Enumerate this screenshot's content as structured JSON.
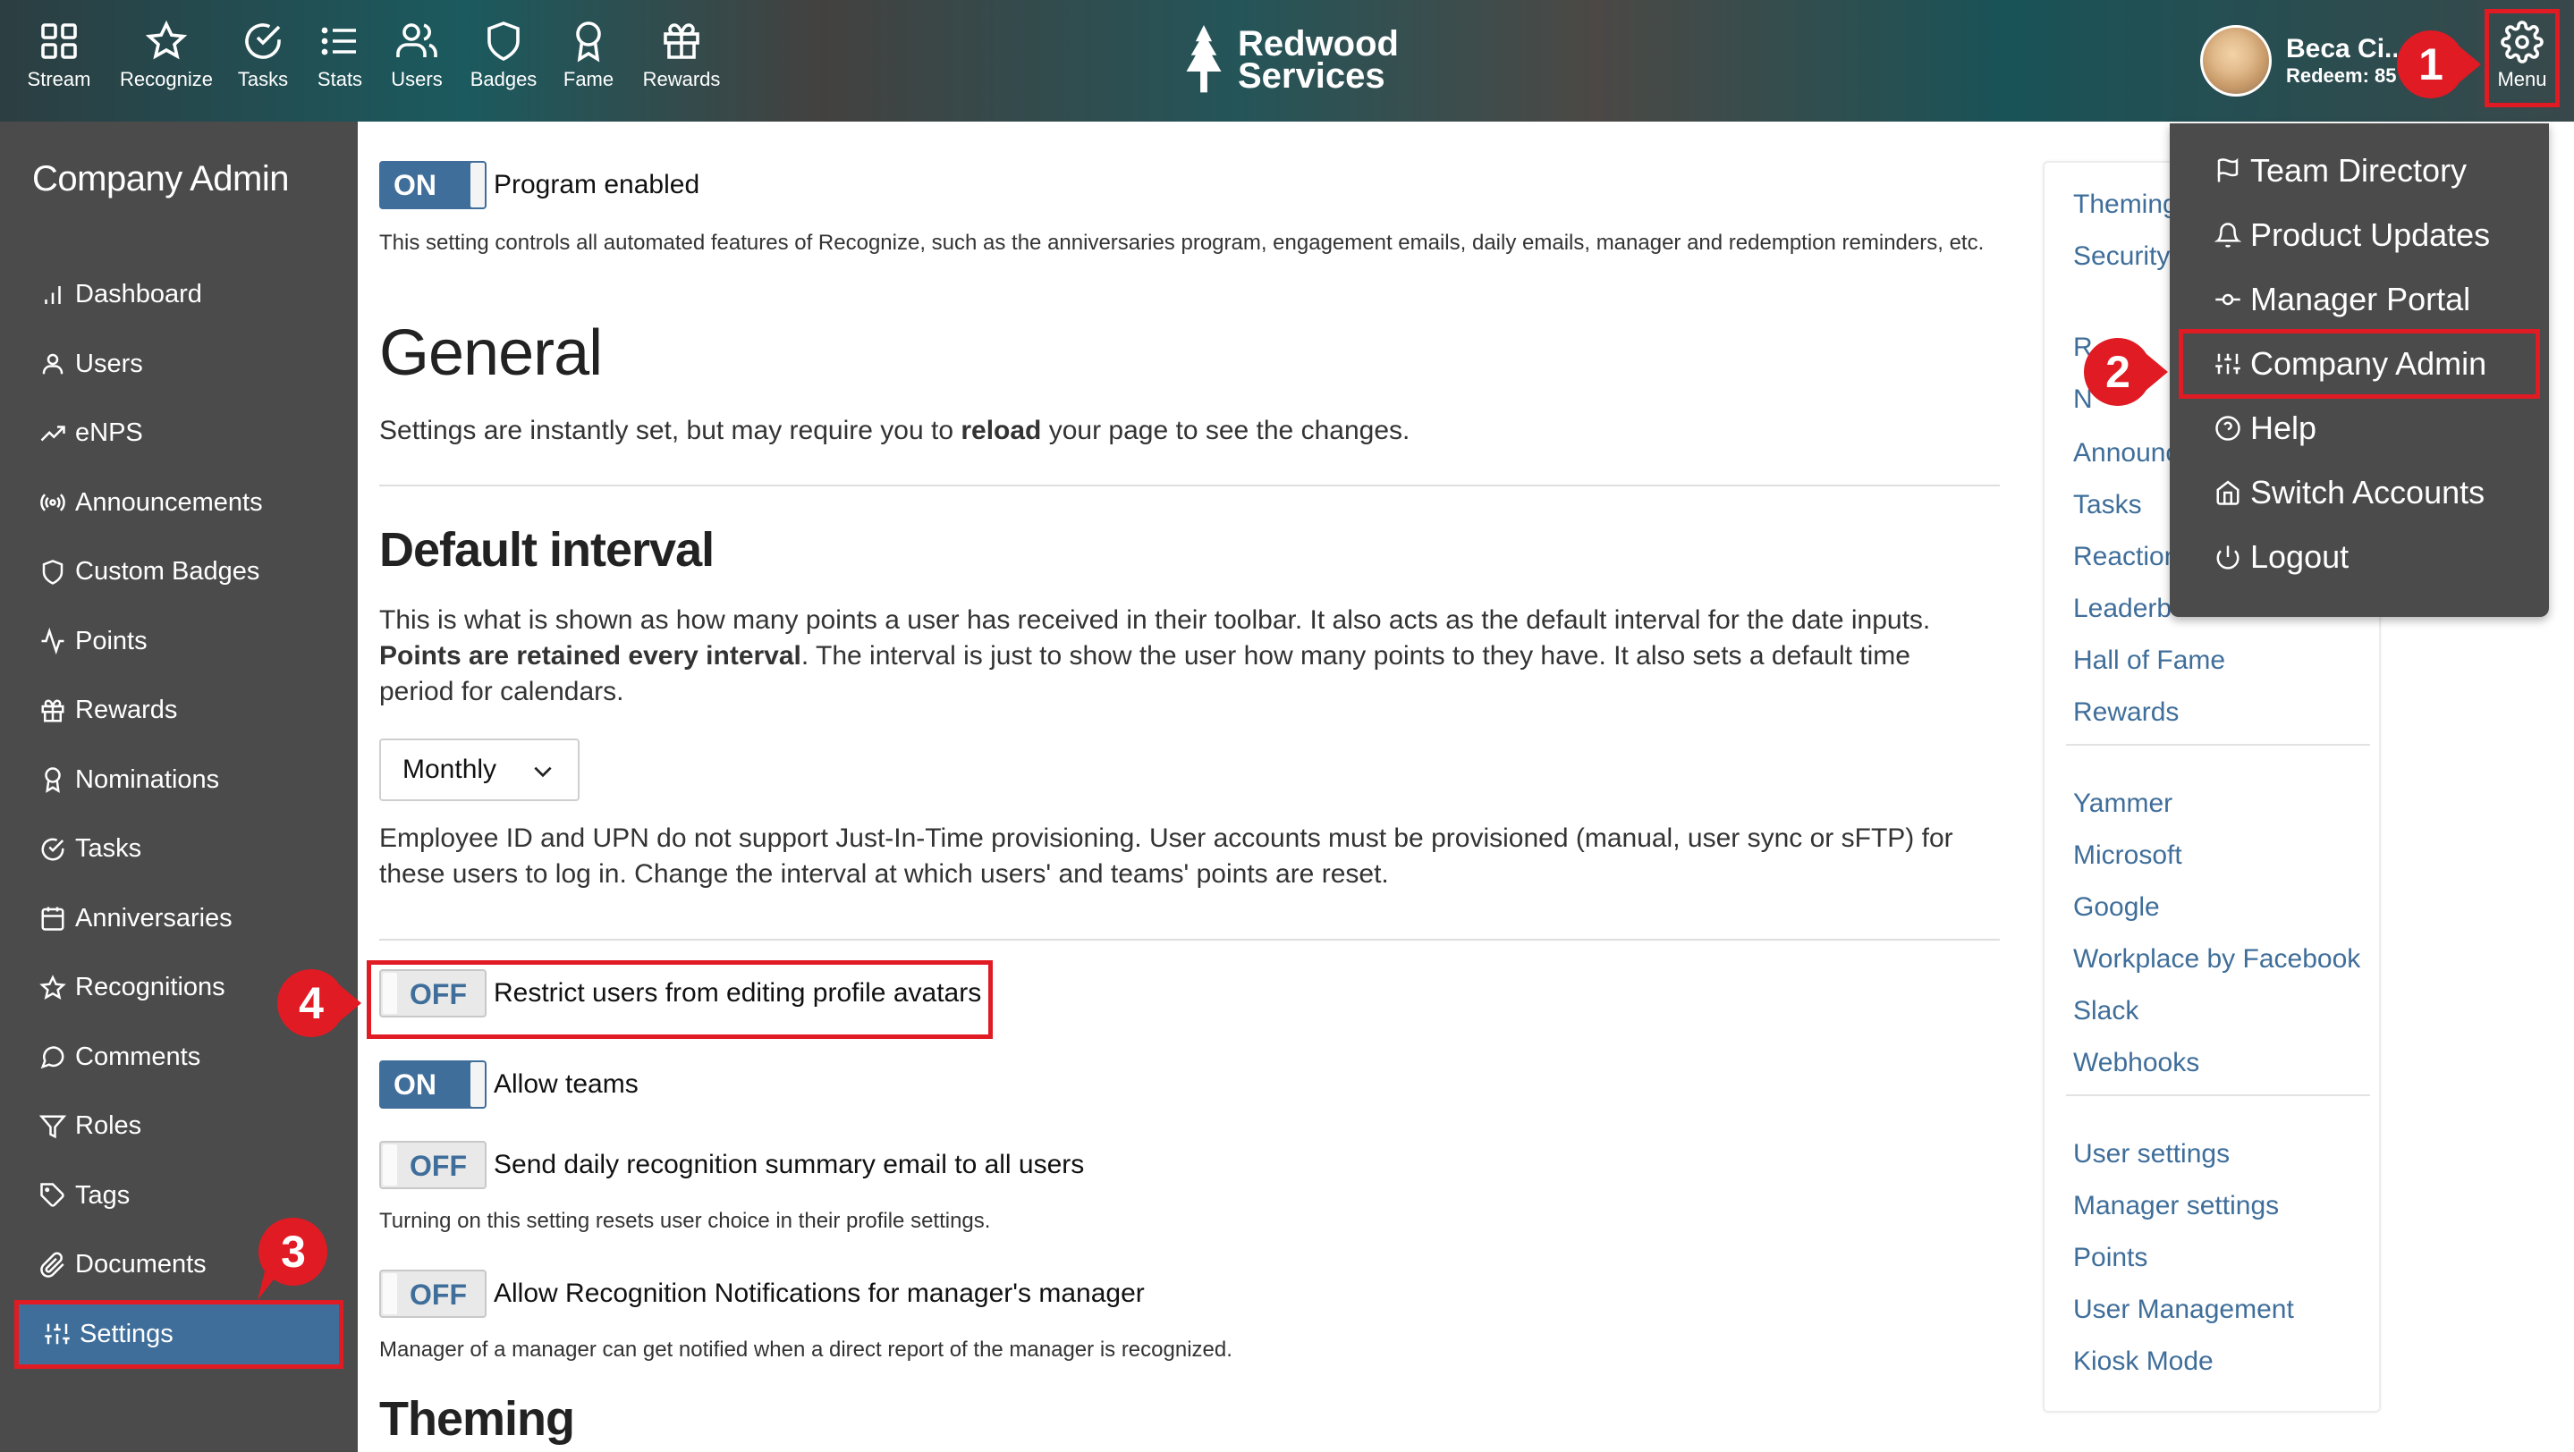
{
  "nav": {
    "items": [
      {
        "label": "Stream",
        "icon": "grid-icon"
      },
      {
        "label": "Recognize",
        "icon": "star-icon"
      },
      {
        "label": "Tasks",
        "icon": "check-circle-icon"
      },
      {
        "label": "Stats",
        "icon": "list-icon"
      },
      {
        "label": "Users",
        "icon": "users-icon"
      },
      {
        "label": "Badges",
        "icon": "shield-icon"
      },
      {
        "label": "Fame",
        "icon": "award-icon"
      },
      {
        "label": "Rewards",
        "icon": "gift-icon"
      }
    ],
    "brand": {
      "line1": "Redwood",
      "line2": "Services"
    },
    "user": {
      "name": "Beca Ci..",
      "redeem": "Redeem: 85p"
    },
    "menu_label": "Menu"
  },
  "sidebar": {
    "title": "Company Admin",
    "items": [
      {
        "label": "Dashboard",
        "icon": "bar-chart-icon"
      },
      {
        "label": "Users",
        "icon": "user-icon"
      },
      {
        "label": "eNPS",
        "icon": "trend-up-icon"
      },
      {
        "label": "Announcements",
        "icon": "broadcast-icon"
      },
      {
        "label": "Custom Badges",
        "icon": "shield-icon"
      },
      {
        "label": "Points",
        "icon": "activity-icon"
      },
      {
        "label": "Rewards",
        "icon": "gift-icon"
      },
      {
        "label": "Nominations",
        "icon": "award-icon"
      },
      {
        "label": "Tasks",
        "icon": "check-circle-icon"
      },
      {
        "label": "Anniversaries",
        "icon": "calendar-icon"
      },
      {
        "label": "Recognitions",
        "icon": "star-icon"
      },
      {
        "label": "Comments",
        "icon": "comment-icon"
      },
      {
        "label": "Roles",
        "icon": "filter-icon"
      },
      {
        "label": "Tags",
        "icon": "tag-icon"
      },
      {
        "label": "Documents",
        "icon": "paperclip-icon"
      },
      {
        "label": "Settings",
        "icon": "sliders-icon",
        "active": true
      }
    ]
  },
  "main": {
    "program": {
      "toggle": "ON",
      "label": "Program enabled",
      "help": "This setting controls all automated features of Recognize, such as the anniversaries program, engagement emails, daily emails, manager and redemption reminders, etc."
    },
    "general_heading": "General",
    "general_pre": "Settings are instantly set, but may require you to ",
    "general_bold": "reload",
    "general_post": " your page to see the changes.",
    "interval_heading": "Default interval",
    "interval_pre": "This is what is shown as how many points a user has received in their toolbar. It also acts as the default interval for the date inputs. ",
    "interval_bold": "Points are retained every interval",
    "interval_post": ". The interval is just to show the user how many points to they have. It also sets a default time period for calendars.",
    "interval_value": "Monthly",
    "provisioning_note": "Employee ID and UPN do not support Just-In-Time provisioning. User accounts must be provisioned (manual, user sync or sFTP) for these users to log in. Change the interval at which users' and teams' points are reset.",
    "toggles": [
      {
        "state": "OFF",
        "label": "Restrict users from editing profile avatars"
      },
      {
        "state": "ON",
        "label": "Allow teams"
      },
      {
        "state": "OFF",
        "label": "Send daily recognition summary email to all users",
        "help": "Turning on this setting resets user choice in their profile settings."
      },
      {
        "state": "OFF",
        "label": "Allow Recognition Notifications for manager's manager",
        "help": "Manager of a manager can get notified when a direct report of the manager is recognized."
      }
    ],
    "theming_heading": "Theming"
  },
  "right_panel": {
    "group1": [
      "Theming",
      "Security",
      "Recognition",
      "Nominations",
      "Announcements",
      "Tasks",
      "Reactions",
      "Leaderboards",
      "Hall of Fame",
      "Rewards"
    ],
    "group1_visible": [
      "Theming",
      "Security",
      "R",
      "N",
      "Announc",
      "Tasks",
      "Reaction",
      "Leaderb",
      "Hall of Fame",
      "Rewards"
    ],
    "group2": [
      "Yammer",
      "Microsoft",
      "Google",
      "Workplace by Facebook",
      "Slack",
      "Webhooks"
    ],
    "group3": [
      "User settings",
      "Manager settings",
      "Points",
      "User Management",
      "Kiosk Mode"
    ]
  },
  "dropdown": {
    "items": [
      {
        "label": "Team Directory",
        "icon": "flag-icon"
      },
      {
        "label": "Product Updates",
        "icon": "bell-icon"
      },
      {
        "label": "Manager Portal",
        "icon": "commit-icon"
      },
      {
        "label": "Company Admin",
        "icon": "sliders-icon"
      },
      {
        "label": "Help",
        "icon": "help-circle-icon"
      },
      {
        "label": "Switch Accounts",
        "icon": "home-icon"
      },
      {
        "label": "Logout",
        "icon": "power-icon"
      }
    ]
  },
  "markers": [
    "1",
    "2",
    "3",
    "4"
  ],
  "colors": {
    "accent": "#3f6e9a",
    "callout": "#e01b24",
    "sidebar": "#4b4b4b"
  }
}
